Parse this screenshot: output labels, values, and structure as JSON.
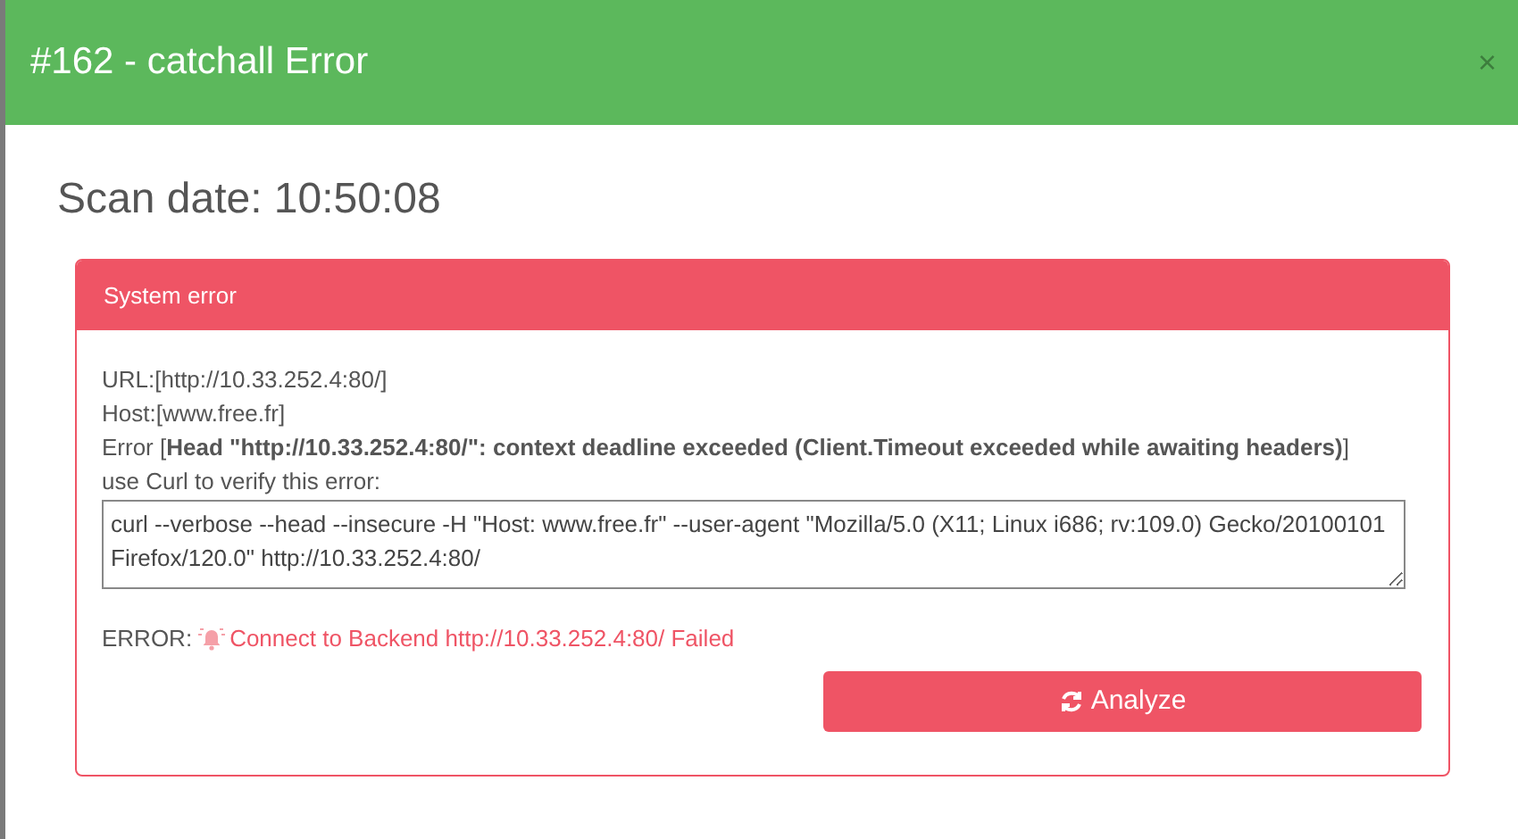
{
  "modal": {
    "title": "#162 - catchall Error",
    "close": "×"
  },
  "scan_date": "Scan date: 10:50:08",
  "panel": {
    "title": "System error",
    "lines": [
      "URL:[http://10.33.252.4:80/]",
      "Host:[www.free.fr]",
      "Error [**Head \"http://10.33.252.4:80/\": context deadline exceeded (Client.Timeout exceeded while awaiting headers)**]",
      "use Curl to verify this error:"
    ],
    "command": "curl --verbose --head --insecure -H \"Host: www.free.fr\" --user-agent \"Mozilla/5.0 (X11; Linux i686; rv:109.0) Gecko/20100101 Firefox/120.0\" http://10.33.252.4:80/",
    "error_label": "ERROR:",
    "error_message": "Connect to Backend http://10.33.252.4:80/ Failed",
    "button": "Analyze"
  }
}
